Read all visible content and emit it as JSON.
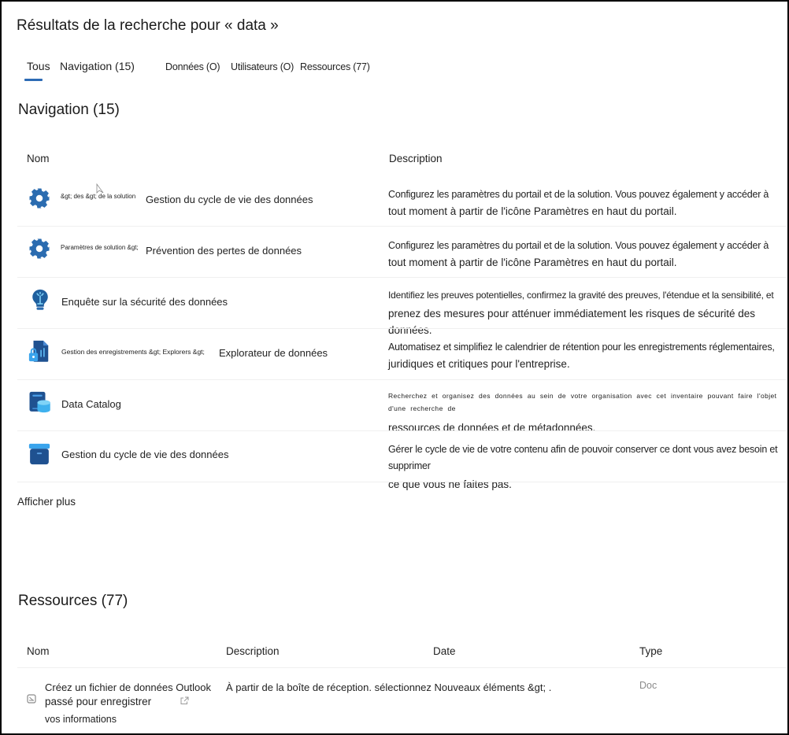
{
  "page": {
    "title": "Résultats de la recherche pour « data »"
  },
  "tabs": [
    {
      "label": "Tous",
      "active": true
    },
    {
      "label": "Navigation (15)",
      "active": false
    },
    {
      "label": "Données (O)",
      "active": false
    },
    {
      "label": "Utilisateurs (O)",
      "active": false
    },
    {
      "label": "Ressources (77)",
      "active": false
    }
  ],
  "accent_color": "#2d6bb5",
  "navigation": {
    "title": "Navigation (15)",
    "columns": {
      "name": "Nom",
      "description": "Description"
    },
    "rows": [
      {
        "icon": "gear-icon",
        "breadcrumb": "&gt; des &gt; de la solution",
        "name": "Gestion du cycle de vie des données",
        "description_line1": "Configurez les paramètres du portail et de la solution. Vous pouvez également y accéder à",
        "description_line2": "tout moment à partir de l'icône Paramètres en haut du portail."
      },
      {
        "icon": "gear-icon",
        "breadcrumb": "Paramètres de solution &gt;",
        "name": "Prévention des pertes de données",
        "description_line1": "Configurez les paramètres du portail et de la solution. Vous pouvez également y accéder à",
        "description_line2": "tout moment à partir de l'icône Paramètres en haut du portail."
      },
      {
        "icon": "lightbulb-icon",
        "breadcrumb": "",
        "name": "Enquête sur la sécurité des données",
        "description_line1": "Identifiez les preuves potentielles, confirmez la gravité des preuves, l'étendue et la sensibilité, et",
        "description_line2": "prenez des mesures pour atténuer immédiatement les risques de sécurité des données."
      },
      {
        "icon": "records-explorer-icon",
        "breadcrumb": "Gestion des enregistrements &gt; Explorers &gt;",
        "name": "Explorateur de données",
        "description_line1": "Automatisez et simplifiez le calendrier de rétention pour les enregistrements réglementaires,",
        "description_line2": "juridiques et critiques pour l'entreprise."
      },
      {
        "icon": "data-catalog-icon",
        "breadcrumb": "",
        "name": "Data Catalog",
        "description_line1": "Recherchez et organisez des données au sein de votre organisation avec cet inventaire pouvant faire l'objet d'une recherche de",
        "description_line2": "ressources de données et de métadonnées."
      },
      {
        "icon": "archive-box-icon",
        "breadcrumb": "",
        "name": "Gestion du cycle de vie des données",
        "description_line1": "Gérer le cycle de vie de votre contenu afin de pouvoir conserver ce dont vous avez besoin et supprimer",
        "description_line2": "ce que vous ne faites pas."
      }
    ],
    "show_more": "Afficher plus"
  },
  "resources": {
    "title": "Ressources (77)",
    "columns": {
      "name": "Nom",
      "description": "Description",
      "date": "Date",
      "type": "Type"
    },
    "rows": [
      {
        "icon": "document-icon",
        "name_line1": "Créez un fichier de données Outlook",
        "name_line2": "passé pour enregistrer",
        "name_line3": "vos informations",
        "description": "À partir de la boîte de réception. sélectionnez Nouveaux éléments &gt; .",
        "date": "",
        "type": "Doc"
      }
    ]
  }
}
